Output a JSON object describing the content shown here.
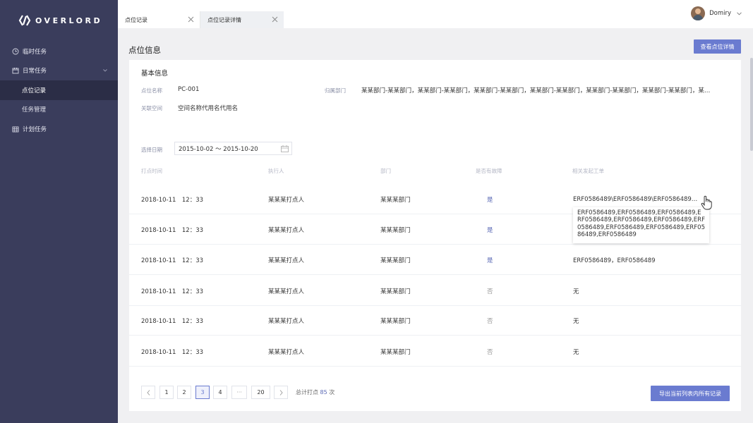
{
  "brand": {
    "name": "OVERLORD"
  },
  "sidebar": {
    "items": [
      {
        "label": "临时任务",
        "icon": "clock-icon"
      },
      {
        "label": "日常任务",
        "icon": "calendar-icon"
      },
      {
        "label": "点位记录"
      },
      {
        "label": "任务管理"
      },
      {
        "label": "计划任务",
        "icon": "calendar-grid-icon"
      }
    ]
  },
  "tabs": [
    {
      "label": "点位记录"
    },
    {
      "label": "点位记录详情"
    }
  ],
  "user": {
    "name": "Domiry"
  },
  "page": {
    "title": "点位信息",
    "view_button": "查看点位详情"
  },
  "basic_info": {
    "title": "基本信息",
    "name_label": "点位名称",
    "name_value": "PC-001",
    "dept_label": "归属部门",
    "dept_value": "某某部门-某某部门，某某部门-某某部门，某某部门-某某部门，某某部门-某某部门，某某部门-某某部门，某某部门-某某部门，某…",
    "space_label": "关联空间",
    "space_value": "空间名称代用名代用名"
  },
  "filter": {
    "date_label": "选择日期",
    "date_value": "2015-10-02  ～  2015-10-20"
  },
  "table": {
    "headers": [
      "打点时间",
      "执行人",
      "部门",
      "是否有故障",
      "相关发起工单"
    ],
    "rows": [
      {
        "time": "2018-10-11　12：33",
        "person": "某某某打点人",
        "dept": "某某某部门",
        "fault": "是",
        "order": "ERF0586489\\ERF0586489\\ERF0586489…"
      },
      {
        "time": "2018-10-11　12：33",
        "person": "某某某打点人",
        "dept": "某某某部门",
        "fault": "是",
        "order": ""
      },
      {
        "time": "2018-10-11　12：33",
        "person": "某某某打点人",
        "dept": "某某某部门",
        "fault": "是",
        "order": "ERF0586489，ERF0586489"
      },
      {
        "time": "2018-10-11　12：33",
        "person": "某某某打点人",
        "dept": "某某某部门",
        "fault": "否",
        "order": "无"
      },
      {
        "time": "2018-10-11　12：33",
        "person": "某某某打点人",
        "dept": "某某某部门",
        "fault": "否",
        "order": "无"
      },
      {
        "time": "2018-10-11　12：33",
        "person": "某某某打点人",
        "dept": "某某某部门",
        "fault": "否",
        "order": "无"
      }
    ]
  },
  "tooltip": {
    "text": "ERF0586489,ERF0586489,ERF0586489,ERF0586489,ERF0586489,ERF0586489,ERF0586489,ERF0586489,ERF0586489,ERF0586489,ERF0586489"
  },
  "pagination": {
    "pages": [
      "1",
      "2",
      "3",
      "4",
      "···",
      "20"
    ],
    "current": "3",
    "total_prefix": "总计打点",
    "total_count": "85",
    "total_suffix": "次"
  },
  "export_button": "导出当前列表内所有记录",
  "colors": {
    "sidebar_bg": "#3a3d5c",
    "accent": "#6a7bd0"
  }
}
